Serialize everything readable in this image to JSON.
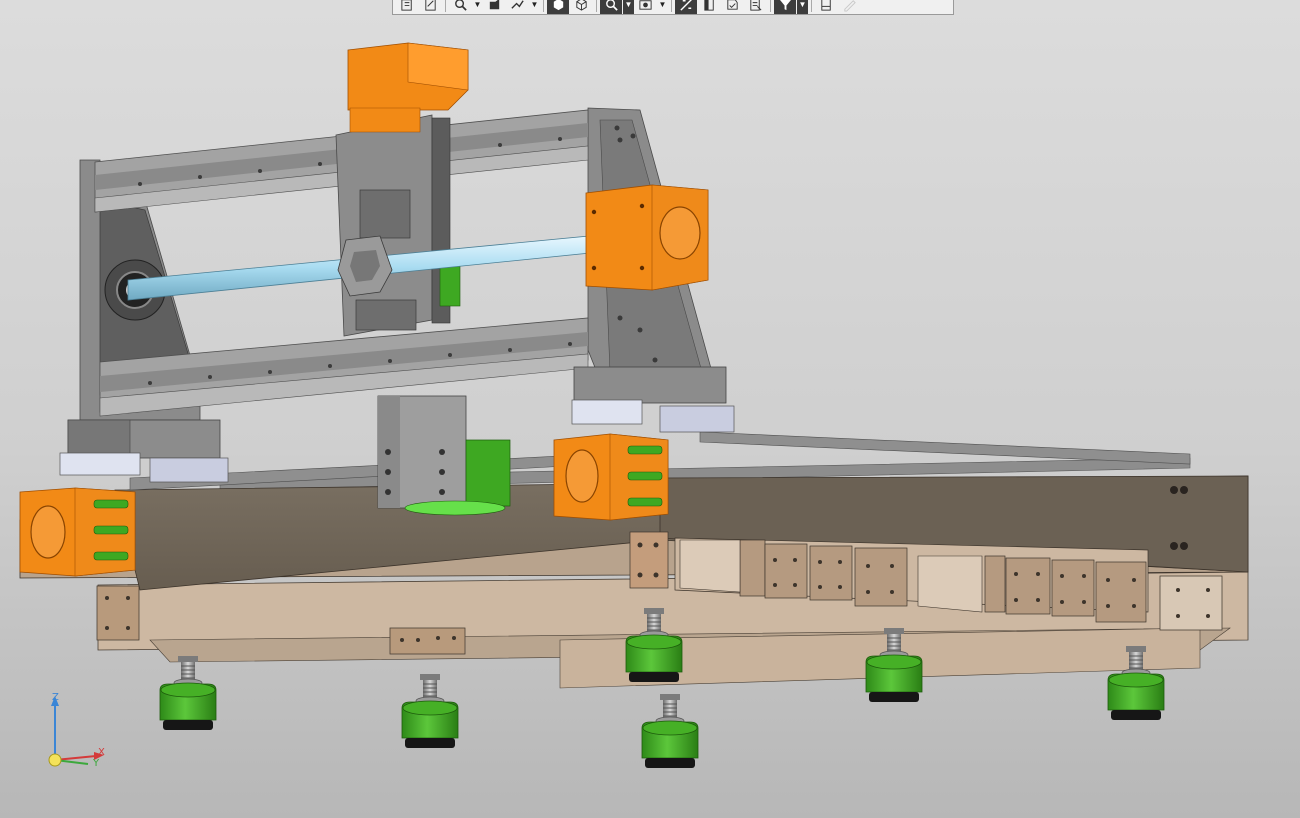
{
  "app": {
    "title": ""
  },
  "colors": {
    "background_top": "#dcdcdc",
    "background_bottom": "#b7b7b7",
    "frame_dark": "#6b6154",
    "frame_light": "#cbb59e",
    "aluminum": "#9a9a9a",
    "motor_mount": "#f28a16",
    "rod": "#bfe6f5",
    "feet": "#3ea822",
    "toolbar_bg": "#f0f0f0",
    "toolbar_active": "#3d3d3d"
  },
  "toolbar": {
    "buttons": [
      {
        "icon": "view-orient-icon",
        "active": false,
        "caret": false
      },
      {
        "icon": "zoom-fit-icon",
        "active": false,
        "caret": false
      },
      {
        "icon": "zoom-window-icon",
        "active": false,
        "caret": true
      },
      {
        "icon": "rotate-view-icon",
        "active": false,
        "caret": false
      },
      {
        "icon": "pan-icon",
        "active": false,
        "caret": true
      },
      {
        "icon": "shaded-edges-icon",
        "active": true,
        "caret": false
      },
      {
        "icon": "wireframe-icon",
        "active": false,
        "caret": false
      },
      {
        "icon": "section-view-icon",
        "active": true,
        "caret": true
      },
      {
        "icon": "display-style-icon",
        "active": false,
        "caret": true
      },
      {
        "icon": "perspective-icon",
        "active": true,
        "caret": false
      },
      {
        "icon": "hide-components-icon",
        "active": false,
        "caret": false
      },
      {
        "icon": "show-all-icon",
        "active": false,
        "caret": false
      },
      {
        "icon": "layers-icon",
        "active": false,
        "caret": false
      },
      {
        "icon": "filter-icon",
        "active": true,
        "caret": true
      },
      {
        "icon": "measure-icon",
        "active": false,
        "caret": false
      },
      {
        "icon": "sketch-disabled-icon",
        "active": false,
        "caret": false
      }
    ]
  },
  "triad": {
    "z_label": "Z",
    "x_label": "X",
    "y_label": "Y"
  }
}
